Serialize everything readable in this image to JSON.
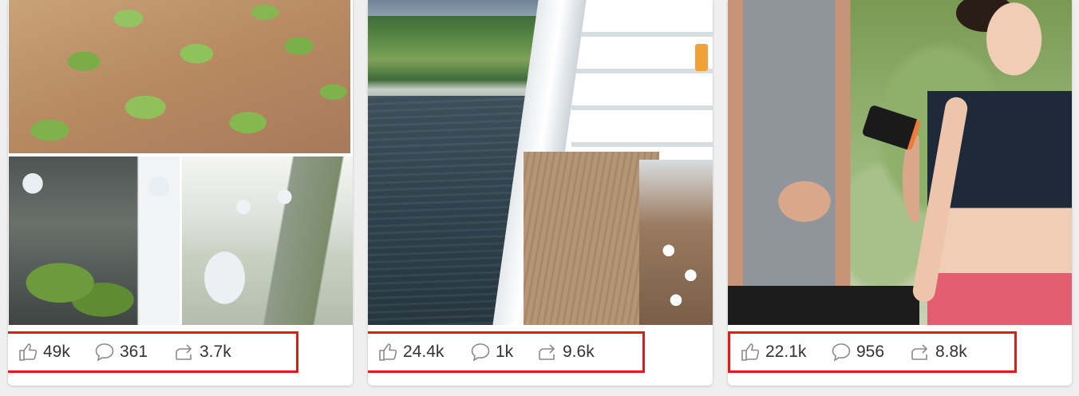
{
  "posts": [
    {
      "likes": "49k",
      "comments": "361",
      "shares": "3.7k"
    },
    {
      "likes": "24.4k",
      "comments": "1k",
      "shares": "9.6k"
    },
    {
      "likes": "22.1k",
      "comments": "956",
      "shares": "8.8k"
    }
  ],
  "icons": {
    "like": "thumbs-up-icon",
    "comment": "speech-bubble-icon",
    "share": "share-arrow-icon"
  },
  "colors": {
    "highlight": "#e11a1a",
    "stat_text": "#333333",
    "icon_stroke": "#8a8a8a"
  }
}
